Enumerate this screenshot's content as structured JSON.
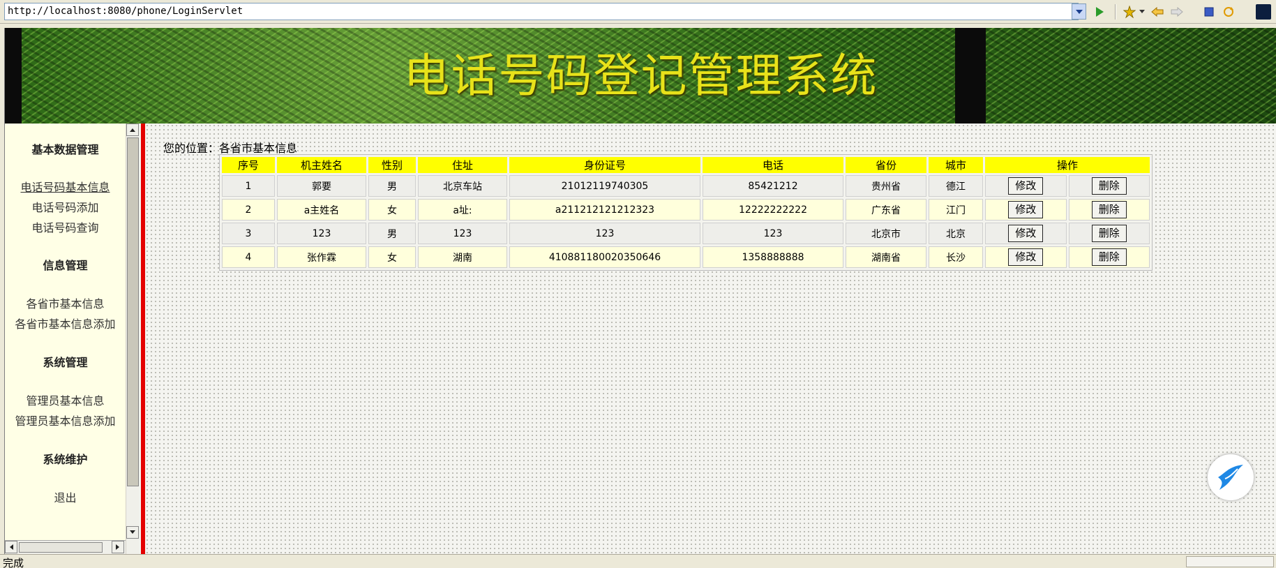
{
  "browser": {
    "url": "http://localhost:8080/phone/LoginServlet",
    "status": "完成"
  },
  "banner": {
    "title": "电话号码登记管理系统"
  },
  "sidebar": {
    "groups": [
      {
        "title": "基本数据管理",
        "items": [
          "电话号码基本信息",
          "电话号码添加",
          "电话号码查询"
        ]
      },
      {
        "title": "信息管理",
        "items": [
          "各省市基本信息",
          "各省市基本信息添加"
        ]
      },
      {
        "title": "系统管理",
        "items": [
          "管理员基本信息",
          "管理员基本信息添加"
        ]
      },
      {
        "title": "系统维护",
        "items": [
          "退出"
        ]
      }
    ]
  },
  "main": {
    "breadcrumb": "您的位置：各省市基本信息",
    "table": {
      "headers": [
        "序号",
        "机主姓名",
        "性别",
        "住址",
        "身份证号",
        "电话",
        "省份",
        "城市",
        "操作"
      ],
      "rows": [
        [
          "1",
          "郭要",
          "男",
          "北京车站",
          "21012119740305",
          "85421212",
          "贵州省",
          "德江"
        ],
        [
          "2",
          "a主姓名",
          "女",
          "a址:",
          "a211212121212323",
          "12222222222",
          "广东省",
          "江门"
        ],
        [
          "3",
          "123",
          "男",
          "123",
          "123",
          "123",
          "北京市",
          "北京"
        ],
        [
          "4",
          "张作霖",
          "女",
          "湖南",
          "410881180020350646",
          "1358888888",
          "湖南省",
          "长沙"
        ]
      ],
      "edit_label": "修改",
      "delete_label": "删除"
    }
  },
  "colors": {
    "header_bg": "#ffff00",
    "accent_red": "#e40000",
    "title_yellow": "#e8e21a"
  }
}
